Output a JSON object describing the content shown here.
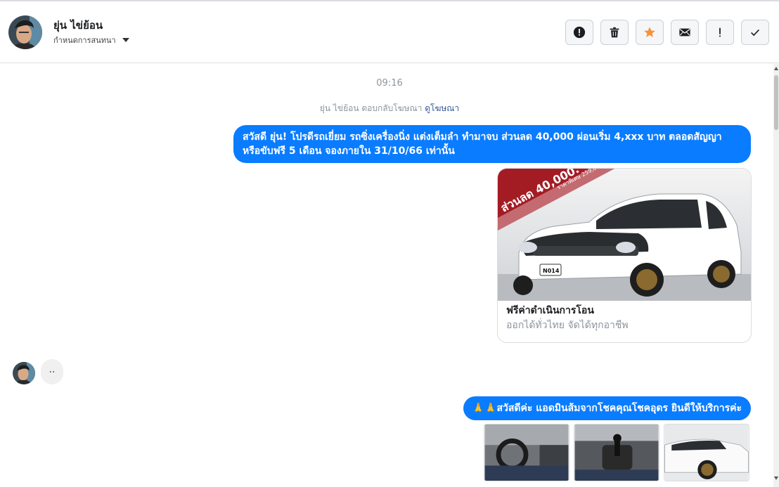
{
  "header": {
    "contact_name": "ยุ่น ไข่ย้อน",
    "assign_label": "กำหนดการสนทนา",
    "actions": [
      {
        "name": "report-icon"
      },
      {
        "name": "trash-icon"
      },
      {
        "name": "star-icon"
      },
      {
        "name": "mail-icon"
      },
      {
        "name": "exclamation-icon"
      },
      {
        "name": "check-icon"
      }
    ]
  },
  "chat": {
    "timestamp": "09:16",
    "system_prefix": "ยุ่น ไข่ย้อน ตอบกลับโฆษณา",
    "system_link": "ดูโฆษณา",
    "message1": "สวัสดี ยุ่น! โปรดีรถเยี่ยม รถซิ่งเครื่องนิ่ง แต่งเต็มลำ ทำมาจบ ส่วนลด 40,000 ผ่อนเริ่ม 4,xxx บาท ตลอดสัญญา หรือขับฟรี 5 เดือน จองภายใน 31/10/66 เท่านั้น",
    "card": {
      "title": "ฟรีค่าดำเนินการโอน",
      "subtitle": "ออกได้ทั่วไทย จัดได้ทุกอาชีพ",
      "banner_text": "ส่วนลด 40,000.",
      "banner_price": "ราคาพิเศษ 259,000.",
      "plate": "N014"
    },
    "typing_text": "..",
    "message2": "🙏🙏สวัสดีค่ะ แอดมินส้มจากโชคคุณโชคอุดร ยินดีให้บริการค่ะ"
  },
  "colors": {
    "bubble": "#0a7cff",
    "star": "#f7923a"
  }
}
